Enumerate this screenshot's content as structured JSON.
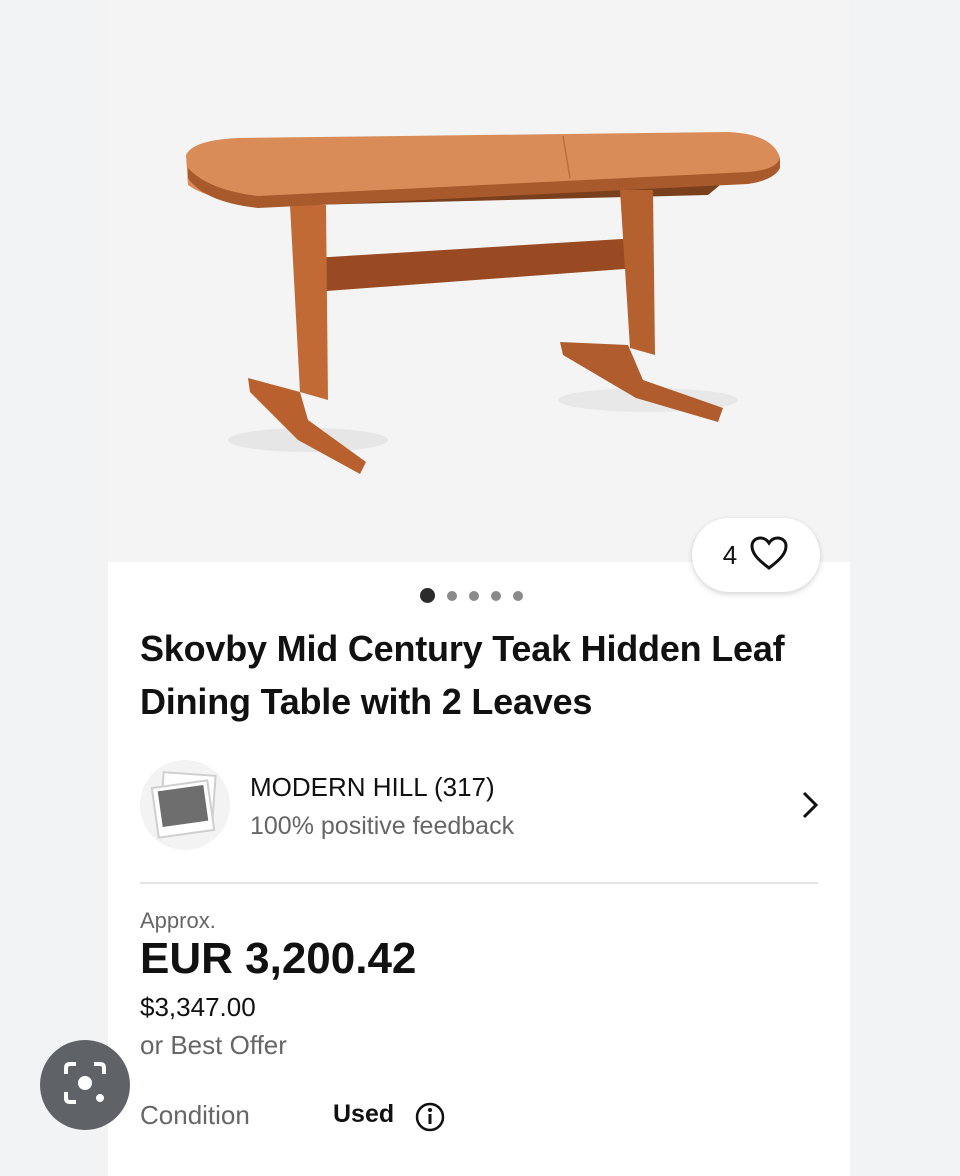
{
  "listing": {
    "title": "Skovby Mid Century Teak Hidden Leaf Dining Table with 2 Leaves",
    "watch_count": "4",
    "image_count": 5,
    "active_image": 1
  },
  "seller": {
    "name": "MODERN HILL (317)",
    "feedback": "100% positive feedback"
  },
  "price": {
    "approx_label": "Approx.",
    "converted": "EUR 3,200.42",
    "original": "$3,347.00",
    "offer_text": "or Best Offer"
  },
  "condition": {
    "label": "Condition",
    "value": "Used"
  },
  "icons": {
    "favorite": "heart-icon",
    "seller_arrow": "chevron-right-icon",
    "info": "info-icon",
    "lens": "camera-lens-icon"
  },
  "colors": {
    "teak": "#c8703f",
    "teak_dark": "#a3552b",
    "text_primary": "#111111",
    "text_secondary": "#666666"
  }
}
